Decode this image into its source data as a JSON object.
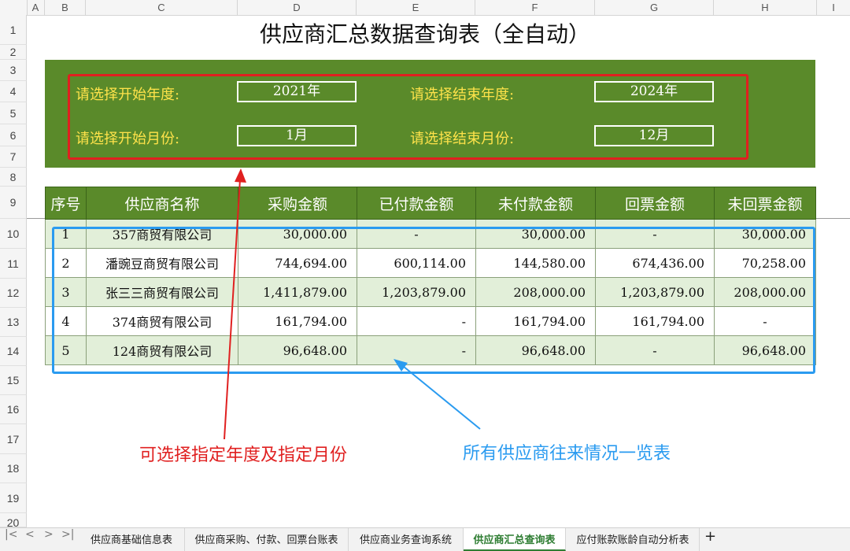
{
  "column_headers": [
    "A",
    "B",
    "C",
    "D",
    "E",
    "F",
    "G",
    "H",
    "I"
  ],
  "row_numbers": [
    "1",
    "2",
    "3",
    "4",
    "5",
    "6",
    "7",
    "8",
    "9",
    "10",
    "11",
    "12",
    "13",
    "14",
    "15",
    "16",
    "17",
    "18",
    "19",
    "20"
  ],
  "title": "供应商汇总数据查询表（全自动）",
  "filters": {
    "start_year_label": "请选择开始年度:",
    "start_year_value": "2021年",
    "end_year_label": "请选择结束年度:",
    "end_year_value": "2024年",
    "start_month_label": "请选择开始月份:",
    "start_month_value": "1月",
    "end_month_label": "请选择结束月份:",
    "end_month_value": "12月"
  },
  "table": {
    "headers": [
      "序号",
      "供应商名称",
      "采购金额",
      "已付款金额",
      "未付款金额",
      "回票金额",
      "未回票金额"
    ],
    "rows": [
      [
        "1",
        "357商贸有限公司",
        "30,000.00",
        "-",
        "30,000.00",
        "-",
        "30,000.00"
      ],
      [
        "2",
        "潘豌豆商贸有限公司",
        "744,694.00",
        "600,114.00",
        "144,580.00",
        "674,436.00",
        "70,258.00"
      ],
      [
        "3",
        "张三三商贸有限公司",
        "1,411,879.00",
        "1,203,879.00",
        "208,000.00",
        "1,203,879.00",
        "208,000.00"
      ],
      [
        "4",
        "374商贸有限公司",
        "161,794.00",
        "-",
        "161,794.00",
        "161,794.00",
        "-"
      ],
      [
        "5",
        "124商贸有限公司",
        "96,648.00",
        "-",
        "96,648.00",
        "-",
        "96,648.00"
      ]
    ]
  },
  "annotations": {
    "red_note": "可选择指定年度及指定月份",
    "blue_note": "所有供应商往来情况一览表",
    "red_color": "#e02020",
    "blue_color": "#2a9bf0"
  },
  "sheet_tabs": [
    "供应商基础信息表",
    "供应商采购、付款、回票台账表",
    "供应商业务查询系统",
    "供应商汇总查询表",
    "应付账款账龄自动分析表"
  ],
  "active_tab": "供应商汇总查询表",
  "add_sheet_label": "+",
  "accent_green": "#5a8a2a"
}
